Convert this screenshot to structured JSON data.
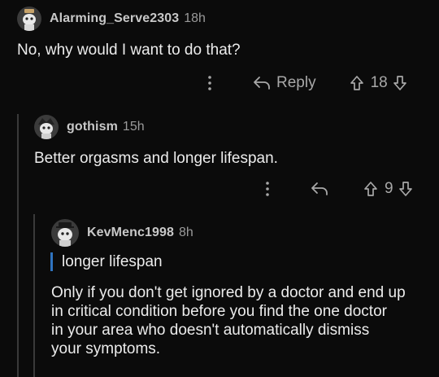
{
  "comments": [
    {
      "username": "Alarming_Serve2303",
      "time": "18h",
      "body": "No, why would I want to do that?",
      "reply_label": "Reply",
      "score": "18"
    },
    {
      "username": "gothism",
      "time": "15h",
      "body": "Better orgasms and longer lifespan.",
      "score": "9"
    },
    {
      "username": "KevMenc1998",
      "time": "8h",
      "quote": "longer lifespan",
      "body_lines": [
        "Only if you don't get ignored by a doctor and end up",
        "in critical condition before you find the one doctor",
        "in your area who doesn't automatically dismiss",
        "your symptoms."
      ]
    }
  ],
  "icons": {
    "more": "more-options-icon",
    "reply": "reply-arrow-icon",
    "upvote": "upvote-arrow-icon",
    "downvote": "downvote-arrow-icon"
  },
  "colors": {
    "background": "#0b0b0b",
    "quote_bar": "#2f74c0",
    "thread_line": "#3a3a3a"
  }
}
